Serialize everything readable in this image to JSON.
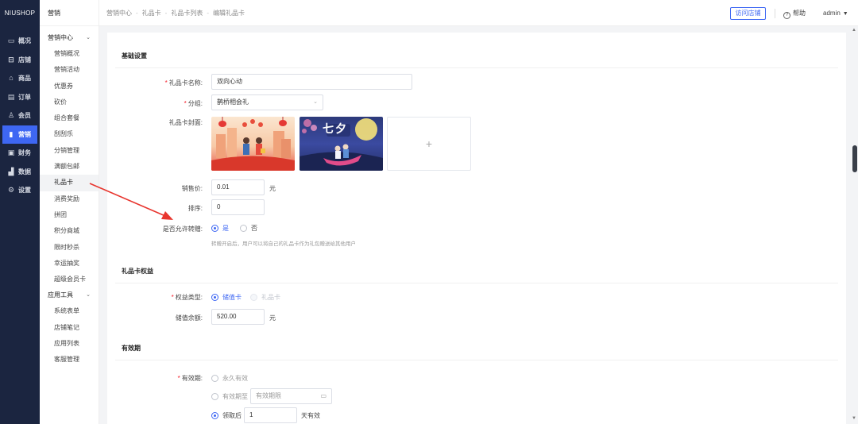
{
  "app": {
    "logo": "NIUSHOP"
  },
  "main_nav": [
    {
      "label": "概况",
      "icon": "monitor-icon",
      "glyph": "▭"
    },
    {
      "label": "店铺",
      "icon": "store-icon",
      "glyph": "⊟"
    },
    {
      "label": "商品",
      "icon": "goods-icon",
      "glyph": "⌂"
    },
    {
      "label": "订单",
      "icon": "order-icon",
      "glyph": "▤"
    },
    {
      "label": "会员",
      "icon": "member-icon",
      "glyph": "♙"
    },
    {
      "label": "营销",
      "icon": "marketing-icon",
      "glyph": "▮"
    },
    {
      "label": "财务",
      "icon": "finance-icon",
      "glyph": "▣"
    },
    {
      "label": "数据",
      "icon": "data-icon",
      "glyph": "▟"
    },
    {
      "label": "设置",
      "icon": "settings-icon",
      "glyph": "⚙"
    }
  ],
  "sub_nav": {
    "title": "营销",
    "group1": "营销中心",
    "items1": [
      "营销概况",
      "营销活动",
      "优惠券",
      "砍价",
      "组合套餐",
      "刮刮乐",
      "分销管理",
      "满额包邮",
      "礼品卡",
      "消费奖励",
      "拼团",
      "积分商城",
      "限时秒杀",
      "幸运抽奖",
      "超级会员卡"
    ],
    "group2": "应用工具",
    "items2": [
      "系统表单",
      "店铺笔记",
      "应用列表",
      "客服管理"
    ]
  },
  "header": {
    "breadcrumbs": [
      "营销中心",
      "礼品卡",
      "礼品卡列表",
      "编辑礼品卡"
    ],
    "visit_store": "访问店铺",
    "help": "帮助",
    "user": "admin"
  },
  "form": {
    "basic_title": "基础设置",
    "name_label": "礼品卡名称:",
    "name_value": "双向心动",
    "group_label": "分组:",
    "group_value": "鹊桥相会礼",
    "cover_label": "礼品卡封面:",
    "cover2_text": "七夕",
    "upload_plus": "+",
    "price_label": "销售价:",
    "price_value": "0.01",
    "price_unit": "元",
    "sort_label": "排序:",
    "sort_value": "0",
    "transfer_label": "是否允许转赠:",
    "transfer_yes": "是",
    "transfer_no": "否",
    "transfer_hint": "转赠开启后，用户可以将自己的礼品卡作为礼包赠送给其他用户",
    "rights_title": "礼品卡权益",
    "rights_type_label": "权益类型:",
    "rights_stored": "储值卡",
    "rights_gift": "礼品卡",
    "balance_label": "储值余额:",
    "balance_value": "520.00",
    "balance_unit": "元",
    "validity_title": "有效期",
    "validity_label": "有效期:",
    "validity_forever": "永久有效",
    "validity_until": "有效期至",
    "validity_until_placeholder": "有效期限",
    "validity_after": "领取后",
    "validity_days_value": "1",
    "validity_days_unit": "天有效"
  },
  "colors": {
    "primary": "#3e67f3",
    "sidebar": "#1b2540",
    "required": "#f5222d",
    "annotation": "#e8352e"
  }
}
